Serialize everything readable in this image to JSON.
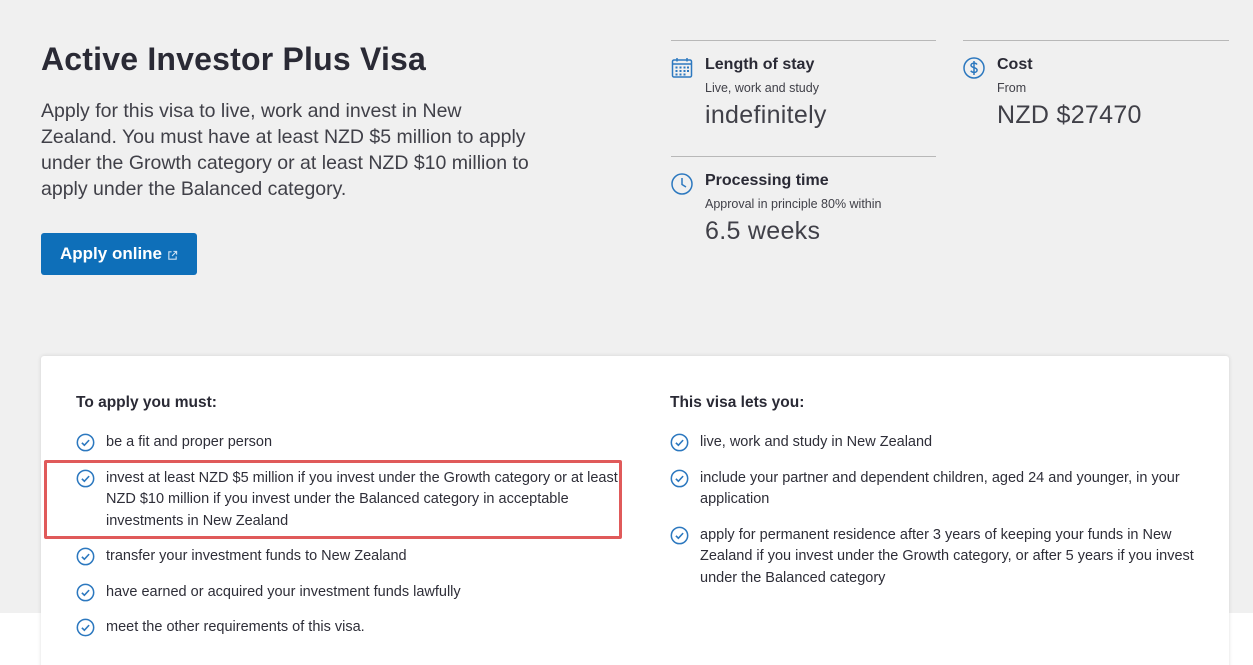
{
  "hero": {
    "title": "Active Investor Plus Visa",
    "intro": "Apply for this visa to live, work and invest in New Zealand. You must have at least NZD $5 million to apply under the Growth category or at least NZD $10 million to apply under the Balanced category.",
    "apply_label": "Apply online"
  },
  "facts": {
    "stay": {
      "title": "Length of stay",
      "sub": "Live, work and study",
      "value": "indefinitely",
      "icon": "calendar-icon"
    },
    "cost": {
      "title": "Cost",
      "sub": "From",
      "value": "NZD $27470",
      "icon": "dollar-circle-icon"
    },
    "processing": {
      "title": "Processing time",
      "sub": "Approval in principle 80% within",
      "value": "6.5 weeks",
      "icon": "clock-icon"
    }
  },
  "requirements": {
    "heading": "To apply you must:",
    "items": [
      "be a fit and proper person",
      "invest at least NZD $5 million if you invest under the Growth category or at least NZD $10 million if you invest under the Balanced category in acceptable investments in New Zealand",
      "transfer your investment funds to New Zealand",
      "have earned or acquired your investment funds lawfully",
      "meet the other requirements of this visa."
    ]
  },
  "benefits": {
    "heading": "This visa lets you:",
    "items": [
      "live, work and study in New Zealand",
      "include your partner and dependent children, aged 24 and younger, in your application",
      "apply for permanent residence after 3 years of keeping your funds in New Zealand if you invest under the Growth category, or after 5 years if you invest under the Balanced category"
    ]
  },
  "colors": {
    "accent": "#0e6fb9",
    "highlight": "#e05a5a",
    "background": "#f0f0f0"
  }
}
